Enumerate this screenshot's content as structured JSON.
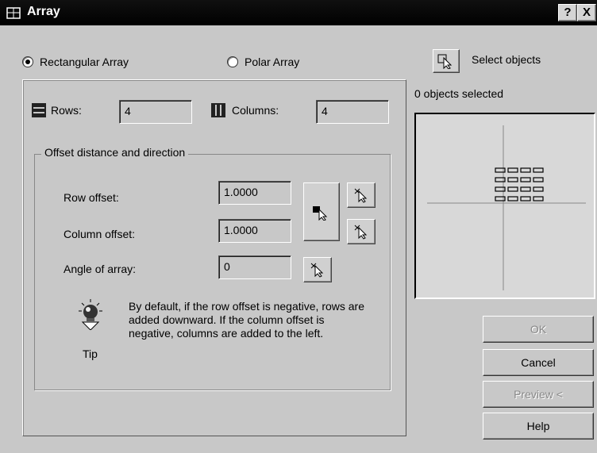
{
  "window": {
    "title": "Array",
    "help_label": "?",
    "close_label": "X"
  },
  "mode": {
    "rectangular_label": "Rectangular Array",
    "polar_label": "Polar Array",
    "selected": "rectangular"
  },
  "rows": {
    "label": "Rows:",
    "value": "4"
  },
  "columns": {
    "label": "Columns:",
    "value": "4"
  },
  "offset_group": {
    "title": "Offset distance and direction",
    "row_offset_label": "Row offset:",
    "row_offset_value": "1.0000",
    "column_offset_label": "Column offset:",
    "column_offset_value": "1.0000",
    "angle_label": "Angle of array:",
    "angle_value": "0"
  },
  "tip": {
    "label": "Tip",
    "text": "By default, if the row offset is negative, rows are added downward.  If the column offset is negative, columns are added to the left."
  },
  "selection": {
    "select_label": "Select objects",
    "count_text": "0 objects selected"
  },
  "buttons": {
    "ok": "OK",
    "cancel": "Cancel",
    "preview": "Preview <",
    "help": "Help"
  },
  "icons": [
    "array-icon",
    "rows-icon",
    "columns-icon",
    "pick-both-offsets-icon",
    "pick-row-offset-icon",
    "pick-column-offset-icon",
    "pick-angle-icon",
    "select-objects-icon",
    "tip-lightbulb-icon"
  ]
}
